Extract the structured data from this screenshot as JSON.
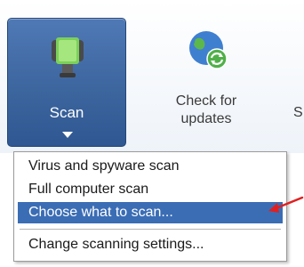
{
  "toolbar": {
    "scan": {
      "label": "Scan",
      "icon": "scanner-icon",
      "active_color": "#3d669f"
    },
    "check_updates": {
      "label": "Check for\nupdates",
      "icon": "globe-update-icon"
    },
    "partial_button": {
      "label": "S"
    }
  },
  "scan_menu": {
    "items": [
      {
        "label": "Virus and spyware scan"
      },
      {
        "label": "Full computer scan"
      },
      {
        "label": "Choose what to scan...",
        "selected": true
      },
      {
        "label": "Change scanning settings..."
      }
    ],
    "highlight_color": "#3b6db5"
  },
  "annotation": {
    "icon": "red-arrow-icon",
    "color": "#e02020"
  }
}
